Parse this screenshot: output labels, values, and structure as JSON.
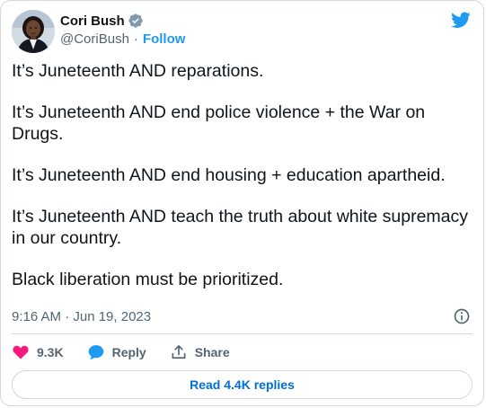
{
  "author": {
    "name": "Cori Bush",
    "handle": "@CoriBush",
    "separator": "·",
    "follow_label": "Follow"
  },
  "tweet": {
    "paragraphs": [
      "It’s Juneteenth AND reparations.",
      "It’s Juneteenth AND end police violence + the War on Drugs.",
      "It’s Juneteenth AND end housing + education apartheid.",
      "It’s Juneteenth AND teach the truth about white supremacy in our country.",
      "Black liberation must be prioritized."
    ],
    "timestamp": "9:16 AM · Jun 19, 2023"
  },
  "actions": {
    "like_count": "9.3K",
    "reply_label": "Reply",
    "share_label": "Share"
  },
  "replies_button": "Read 4.4K replies",
  "colors": {
    "brand_blue": "#1d9bf0",
    "like_red": "#f91880",
    "text_primary": "#0f1419",
    "text_secondary": "#536471",
    "border": "#cfd9de"
  },
  "icons": {
    "verified": "verified-badge-icon",
    "logo": "twitter-bird-icon",
    "info": "info-icon",
    "like": "heart-icon",
    "reply": "speech-bubble-icon",
    "share": "share-upload-icon"
  }
}
